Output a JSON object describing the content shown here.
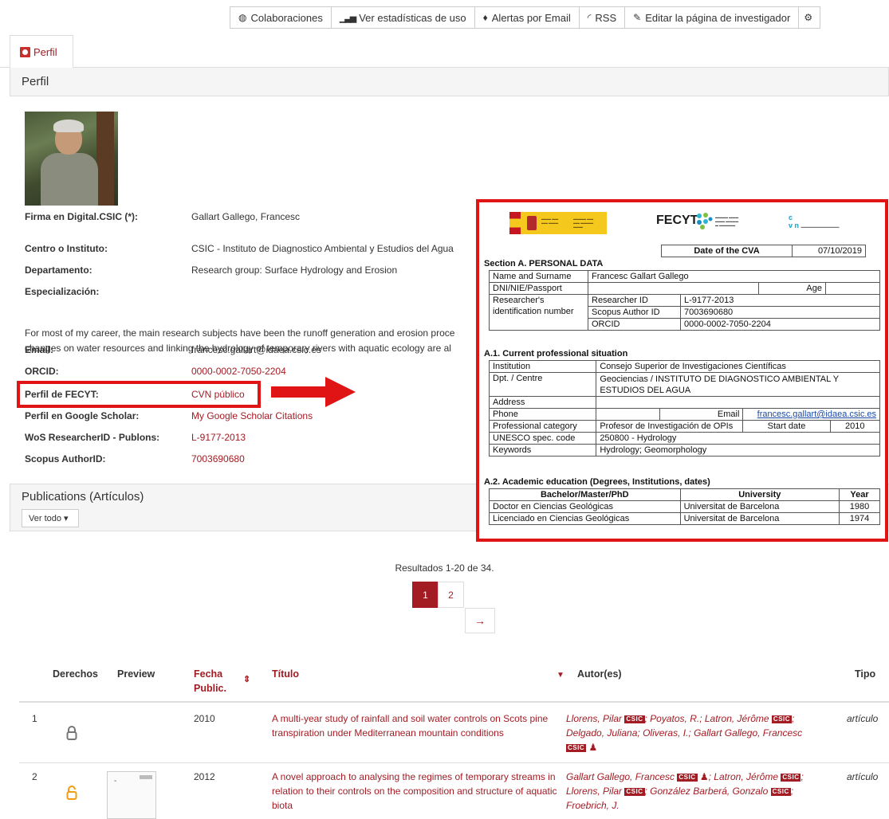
{
  "toolbar": {
    "colaboraciones": "Colaboraciones",
    "estadisticas": "Ver estadísticas de uso",
    "alertas": "Alertas por Email",
    "rss": "RSS",
    "editar": "Editar la página de investigador"
  },
  "tab": {
    "perfil": "Perfil"
  },
  "panel": {
    "title": "Perfil"
  },
  "profile": {
    "firma_label": "Firma en Digital.CSIC (*):",
    "firma_value": "Gallart Gallego, Francesc",
    "centro_label": "Centro o Instituto:",
    "centro_value": "CSIC - Instituto de Diagnostico Ambiental y Estudios del Agua",
    "departamento_label": "Departamento:",
    "departamento_value": "Research group: Surface Hydrology and Erosion",
    "especializacion_label": "Especialización:",
    "para_line1": "For most of my career, the main research subjects have been the runoff generation and erosion proce",
    "para_line2": "changes on water resources and linking the hydrology of temporary rivers with aquatic ecology are al",
    "email_label": "Email:",
    "email_value": "francesc.gallart@idaea.csic.es",
    "orcid_label": "ORCID:",
    "orcid_value": "0000-0002-7050-2204",
    "fecyt_label": "Perfil de FECYT:",
    "fecyt_value": "CVN público",
    "scholar_label": "Perfil en Google Scholar:",
    "scholar_value": "My Google Scholar Citations",
    "wos_label": "WoS ResearcherID - Publons:",
    "wos_value": "L-9177-2013",
    "scopus_label": "Scopus AuthorID:",
    "scopus_value": "7003690680"
  },
  "cva": {
    "fecyt_logo": "FECYT",
    "date_label": "Date of the CVA",
    "date_value": "07/10/2019",
    "secA": "Section A. PERSONAL DATA",
    "name_label": "Name and Surname",
    "name_value": "Francesc Gallart Gallego",
    "dni_label": "DNI/NIE/Passport",
    "age_label": "Age",
    "researcher_label1": "Researcher's",
    "researcher_label2": "identification number",
    "rid_label": "Researcher ID",
    "rid_value": "L-9177-2013",
    "scopus_label": "Scopus Author ID",
    "scopus_value": "7003690680",
    "orcid_label": "ORCID",
    "orcid_value": "0000-0002-7050-2204",
    "secA1": "A.1. Current professional situation",
    "institution_label": "Institution",
    "institution_value": "Consejo Superior de Investigaciones Científicas",
    "dpt_label": "Dpt. / Centre",
    "dpt_value1": "Geociencias / INSTITUTO DE DIAGNOSTICO AMBIENTAL Y",
    "dpt_value2": "ESTUDIOS DEL AGUA",
    "address_label": "Address",
    "phone_label": "Phone",
    "email_label": "Email",
    "email_value": "francesc.gallart@idaea.csic.es",
    "prof_label": "Professional category",
    "prof_value": "Profesor de Investigación de OPIs",
    "start_label": "Start date",
    "start_value": "2010",
    "unesco_label": "UNESCO spec. code",
    "unesco_value": "250800 - Hydrology",
    "keywords_label": "Keywords",
    "keywords_value": "Hydrology; Geomorphology",
    "secA2": "A.2. Academic education  (Degrees, Institutions, dates)",
    "edu_h1": "Bachelor/Master/PhD",
    "edu_h2": "University",
    "edu_h3": "Year",
    "edu1_degree": "Doctor en Ciencias Geológicas",
    "edu1_uni": "Universitat de Barcelona",
    "edu1_year": "1980",
    "edu2_degree": "Licenciado en Ciencias Geológicas",
    "edu2_uni": "Universitat de Barcelona",
    "edu2_year": "1974"
  },
  "publications": {
    "title": "Publications (Artículos)",
    "ver_todo": "Ver todo ▾",
    "results": "Resultados 1-20 de 34.",
    "page1": "1",
    "page2": "2",
    "next": "→",
    "headers": {
      "derechos": "Derechos",
      "preview": "Preview",
      "fecha1": "Fecha",
      "fecha2": "Public.",
      "titulo": "Título",
      "autores": "Autor(es)",
      "tipo": "Tipo"
    },
    "rows": [
      {
        "num": "1",
        "year": "2010",
        "title": "A multi-year study of rainfall and soil water controls on Scots pine transpiration under Mediterranean mountain conditions",
        "a1": "Llorens, Pilar",
        "a2": "; Poyatos, R.; Latron, Jérôme",
        "a3": "; Delgado, Juliana; Oliveras, I.; Gallart Gallego, Francesc",
        "tipo": "artículo"
      },
      {
        "num": "2",
        "year": "2012",
        "title": "A novel approach to analysing the regimes of temporary streams in relation to their controls on the composition and structure of aquatic biota",
        "a1": "Gallart Gallego, Francesc",
        "a2": "; Latron, Jérôme",
        "a3": "; Llorens, Pilar",
        "a4": "; González Barberá, Gonzalo",
        "a5": "; Froebrich, J.",
        "tipo": "artículo"
      }
    ],
    "csic_badge": "CSIC"
  },
  "colors": {
    "accent": "#a31c24",
    "highlight": "#e01414"
  }
}
